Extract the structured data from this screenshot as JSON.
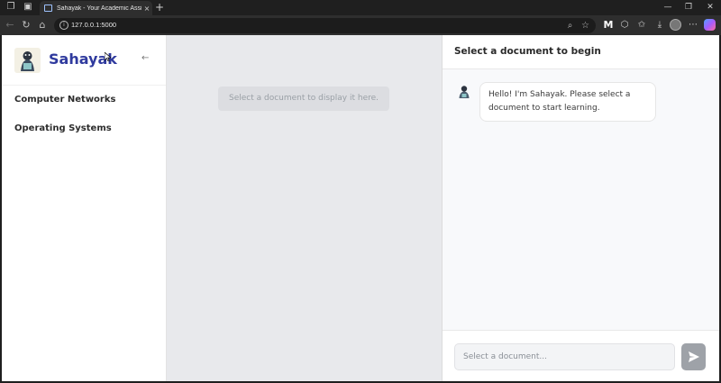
{
  "browser": {
    "tab_title": "Sahayak - Your Academic Assistant",
    "url": "127.0.0.1:5000",
    "new_tab_glyph": "+",
    "tab_close_glyph": "×"
  },
  "sidebar": {
    "brand": "Sahayak",
    "collapse_glyph": "←",
    "items": [
      {
        "label": "Computer Networks"
      },
      {
        "label": "Operating Systems"
      }
    ]
  },
  "viewer": {
    "placeholder": "Select a document to display it here."
  },
  "chat": {
    "title": "Select a document to begin",
    "messages": [
      {
        "sender": "bot",
        "text": "Hello! I'm Sahayak. Please select a document to start learning."
      }
    ],
    "input_placeholder": "Select a document..."
  },
  "colors": {
    "brand": "#2f3a9e",
    "viewer_bg": "#e8e9ec",
    "send_button": "#9ea2a8"
  },
  "icons": {
    "tab_favicon": "document-icon",
    "send": "send-icon",
    "collapse": "arrow-left-icon"
  }
}
